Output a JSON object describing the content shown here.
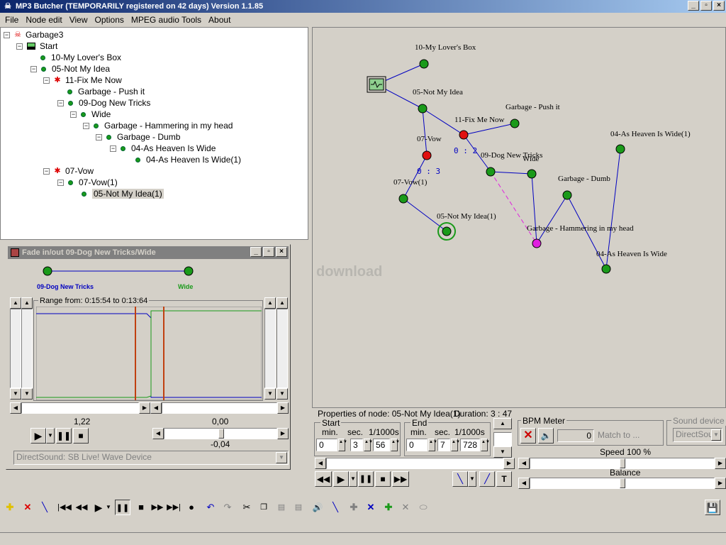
{
  "window": {
    "title": "MP3 Butcher  (TEMPORARILY registered on 42 days)  Version 1.1.85"
  },
  "menu": [
    "File",
    "Node edit",
    "View",
    "Options",
    "MPEG audio Tools",
    "About"
  ],
  "tree": [
    {
      "label": "Garbage3"
    },
    {
      "label": "Start"
    },
    {
      "label": "10-My Lover's Box"
    },
    {
      "label": "05-Not My Idea"
    },
    {
      "label": "11-Fix Me Now"
    },
    {
      "label": "Garbage - Push it"
    },
    {
      "label": "09-Dog New Tricks"
    },
    {
      "label": "Wide"
    },
    {
      "label": "Garbage - Hammering in my head"
    },
    {
      "label": "Garbage - Dumb"
    },
    {
      "label": "04-As Heaven Is Wide"
    },
    {
      "label": "04-As Heaven Is Wide(1)"
    },
    {
      "label": "07-Vow"
    },
    {
      "label": "07-Vow(1)"
    },
    {
      "label": "05-Not My Idea(1)"
    }
  ],
  "graph": {
    "labels": {
      "n10": "10-My Lover's Box",
      "n05": "05-Not My Idea",
      "n11": "11-Fix Me Now",
      "push": "Garbage - Push it",
      "vow": "07-Vow",
      "dog": "09-Dog New Tricks",
      "wide": "Wide",
      "heaven1": "04-As Heaven Is Wide(1)",
      "vow1": "07-Vow(1)",
      "dumb": "Garbage - Dumb",
      "notidea1": "05-Not My Idea(1)",
      "hammer": "Garbage - Hammering in my head",
      "heaven": "04-As Heaven Is Wide"
    },
    "time_fix": "0 : 2",
    "time_vow": "0 : 3",
    "watermark": "download"
  },
  "fade": {
    "title": "Fade in/out 09-Dog New Tricks/Wide",
    "from_label": "09-Dog New Tricks",
    "to_label": "Wide",
    "range": "Range from: 0:15:54 to 0:13:64",
    "left_value": "1,22",
    "right_value": "0,00",
    "balance_value": "-0,04",
    "device": "DirectSound: SB Live! Wave Device"
  },
  "props": {
    "title": "Properties of node: 05-Not My Idea(1)",
    "duration": "Duration: 3 : 47",
    "start_label": "Start",
    "end_label": "End",
    "min_label": "min.",
    "sec_label": "sec.",
    "ms_label": "1/1000s",
    "start_min": "0",
    "start_sec": "3",
    "start_ms": "56",
    "end_min": "0",
    "end_sec": "7",
    "end_ms": "728"
  },
  "bpm": {
    "title": "BPM Meter",
    "value": "0",
    "match": "Match to ...",
    "speed": "Speed 100 %",
    "balance": "Balance"
  },
  "sound_device": {
    "title": "Sound device fo",
    "value": "DirectSou"
  },
  "colors": {
    "accent": "#0a246a",
    "node_green": "#1a9a1a",
    "node_red": "#e01010",
    "node_magenta": "#e020e0",
    "edge_blue": "#0000c0"
  }
}
